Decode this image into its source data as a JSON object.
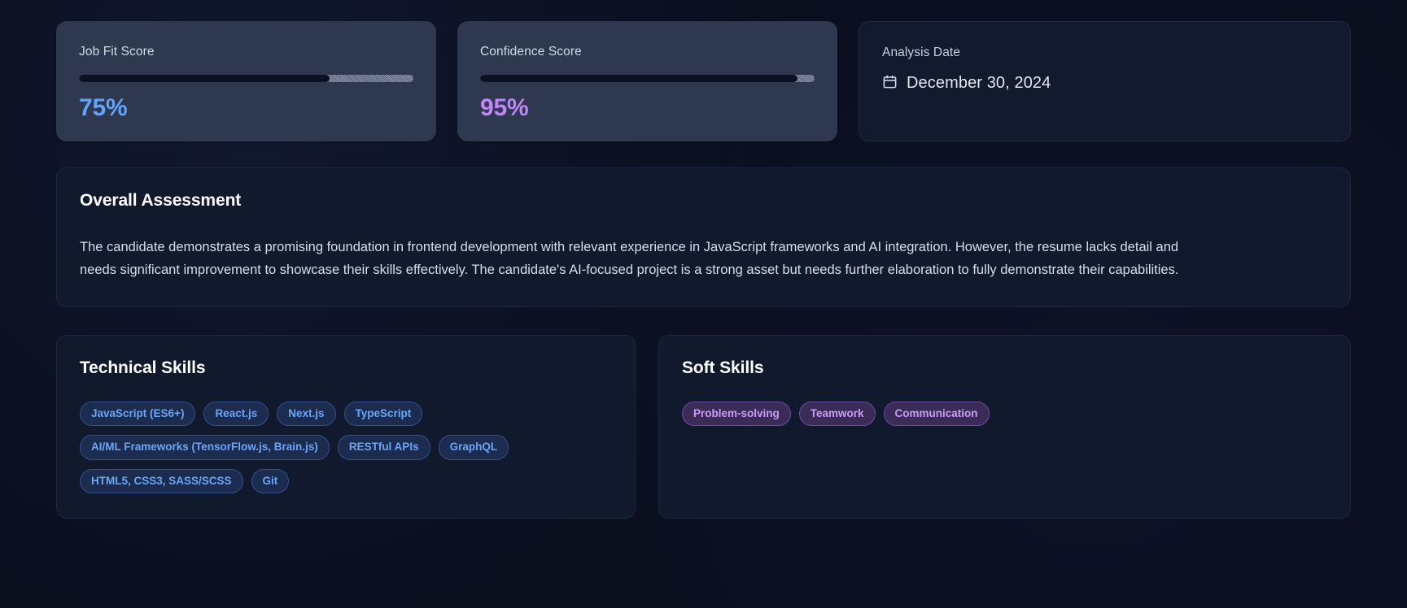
{
  "metrics": {
    "job_fit": {
      "label": "Job Fit Score",
      "value_text": "75%",
      "percent": 75,
      "color": "#60a5fa"
    },
    "confidence": {
      "label": "Confidence Score",
      "value_text": "95%",
      "percent": 95,
      "color": "#c084fc"
    },
    "analysis_date": {
      "label": "Analysis Date",
      "icon": "calendar-icon",
      "value_text": "December 30, 2024"
    }
  },
  "assessment": {
    "title": "Overall Assessment",
    "body": "The candidate demonstrates a promising foundation in frontend development with relevant experience in JavaScript frameworks and AI integration. However, the resume lacks detail and needs significant improvement to showcase their skills effectively. The candidate's AI-focused project is a strong asset but needs further elaboration to fully demonstrate their capabilities."
  },
  "technical_skills": {
    "title": "Technical Skills",
    "tags": [
      "JavaScript (ES6+)",
      "React.js",
      "Next.js",
      "TypeScript",
      "AI/ML Frameworks (TensorFlow.js, Brain.js)",
      "RESTful APIs",
      "GraphQL",
      "HTML5, CSS3, SASS/SCSS",
      "Git"
    ]
  },
  "soft_skills": {
    "title": "Soft Skills",
    "tags": [
      "Problem-solving",
      "Teamwork",
      "Communication"
    ]
  },
  "theme": {
    "page_background": "#0a0f1e",
    "metric_card_background": "#2e3950",
    "panel_background": "#111a2d",
    "panel_border": "#1d2840",
    "tech_tag_color": "#6aa6f7",
    "soft_tag_color": "#c89ef5"
  }
}
